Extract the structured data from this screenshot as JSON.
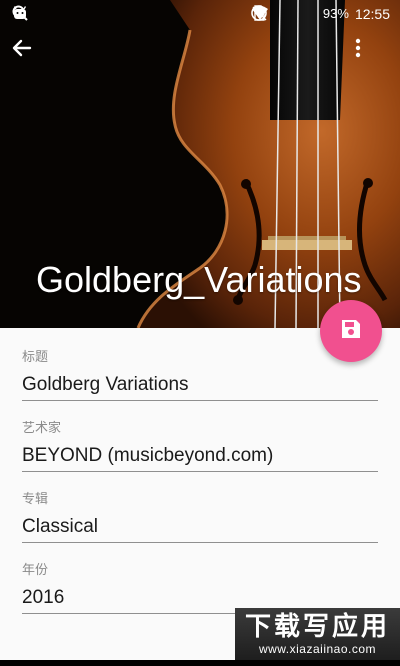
{
  "statusbar": {
    "battery": "93%",
    "time": "12:55"
  },
  "hero": {
    "title": "Goldberg_Variations"
  },
  "form": {
    "fields": [
      {
        "label": "标题",
        "value": "Goldberg Variations"
      },
      {
        "label": "艺术家",
        "value": "BEYOND (musicbeyond.com)"
      },
      {
        "label": "专辑",
        "value": "Classical"
      },
      {
        "label": "年份",
        "value": "2016"
      }
    ]
  },
  "watermark": {
    "top": "下载写应用",
    "bottom": "www.xiazaiinao.com"
  },
  "colors": {
    "fab": "#f1508f",
    "header_bg": "#050302",
    "wood": "#8b3f14"
  },
  "icons": {
    "back": "arrow-left-icon",
    "more": "more-vert-icon",
    "fab": "save-icon"
  }
}
